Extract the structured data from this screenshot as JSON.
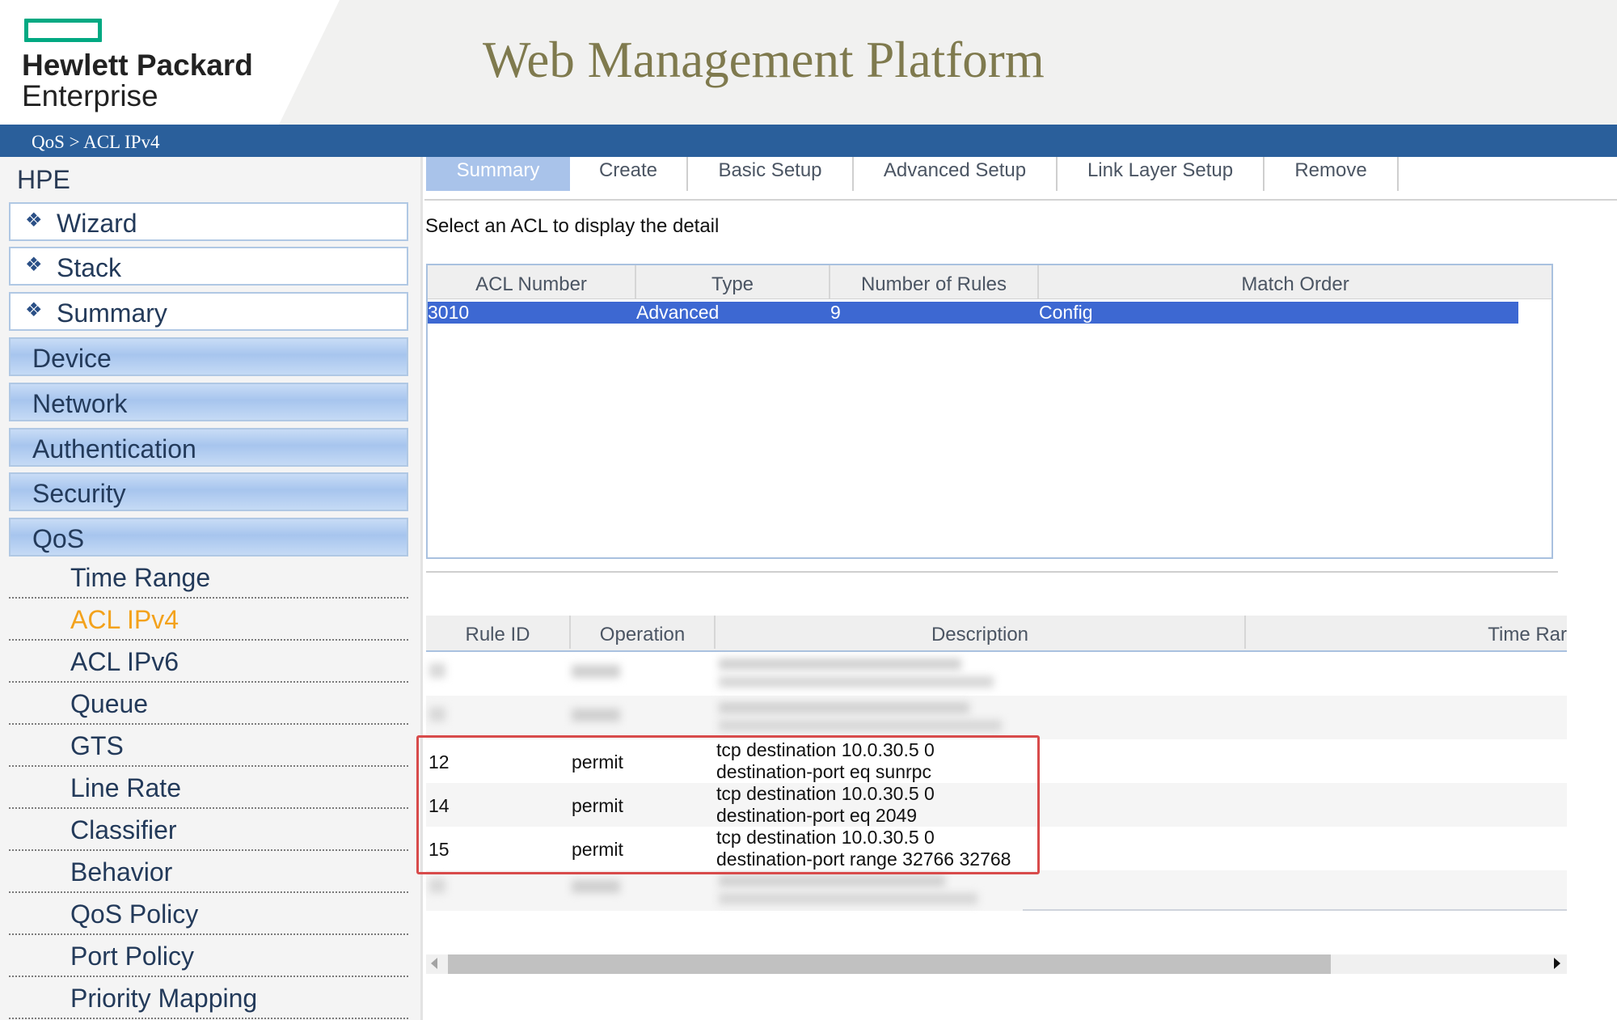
{
  "header": {
    "logo_line1": "Hewlett Packard",
    "logo_line2": "Enterprise",
    "app_title": "Web Management Platform"
  },
  "breadcrumb": "QoS > ACL IPv4",
  "sidebar": {
    "root": "HPE",
    "top_items": [
      {
        "label": "Wizard",
        "icon": "diamond-icon"
      },
      {
        "label": "Stack",
        "icon": "diamond-icon"
      },
      {
        "label": "Summary",
        "icon": "diamond-icon"
      }
    ],
    "sections": [
      "Device",
      "Network",
      "Authentication",
      "Security",
      "QoS"
    ],
    "qos_items": [
      "Time Range",
      "ACL IPv4",
      "ACL IPv6",
      "Queue",
      "GTS",
      "Line Rate",
      "Classifier",
      "Behavior",
      "QoS Policy",
      "Port Policy",
      "Priority Mapping"
    ],
    "active_item": "ACL IPv4",
    "active_color": "#f3a21c"
  },
  "tabs": [
    "Summary",
    "Create",
    "Basic Setup",
    "Advanced Setup",
    "Link Layer Setup",
    "Remove"
  ],
  "active_tab": "Summary",
  "hint": "Select an ACL to display the detail",
  "acl_table": {
    "headers": [
      "ACL Number",
      "Type",
      "Number of Rules",
      "Match Order"
    ],
    "selected_row": [
      "3010",
      "Advanced",
      "9",
      "Config"
    ],
    "selected_color": "#3d68d2"
  },
  "rules_table": {
    "headers": [
      "Rule ID",
      "Operation",
      "Description",
      "Time Rar"
    ],
    "rows": [
      {
        "id": "12",
        "op": "permit",
        "desc1": "tcp destination 10.0.30.5 0",
        "desc2": "destination-port eq sunrpc"
      },
      {
        "id": "14",
        "op": "permit",
        "desc1": "tcp destination 10.0.30.5 0",
        "desc2": "destination-port eq 2049"
      },
      {
        "id": "15",
        "op": "permit",
        "desc1": "tcp destination 10.0.30.5 0",
        "desc2": "destination-port range 32766 32768"
      }
    ],
    "highlight_color": "#d84b4b"
  },
  "colors": {
    "brand_green": "#01a982",
    "breadcrumb_bar": "#2a5f9b",
    "title_olive": "#7f7a4e"
  }
}
